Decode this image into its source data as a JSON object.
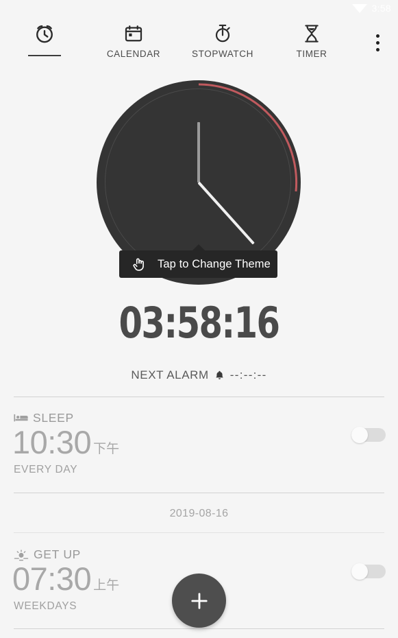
{
  "status_bar": {
    "wifi_icon": "wifi-icon",
    "time": "3:58"
  },
  "tabs": [
    {
      "icon": "alarm-clock-icon",
      "label": "",
      "selected": true
    },
    {
      "icon": "calendar-icon",
      "label": "CALENDAR",
      "selected": false
    },
    {
      "icon": "stopwatch-icon",
      "label": "STOPWATCH",
      "selected": false
    },
    {
      "icon": "hourglass-timer-icon",
      "label": "TIMER",
      "selected": false
    }
  ],
  "overflow_menu": {
    "icon": "more-vertical-icon"
  },
  "clock": {
    "face_color": "#343434",
    "arc_color": "#c05a5e",
    "hour_hand_color": "#9b9b9b",
    "minute_hand_color": "#f0f0f0",
    "seconds_progress_deg": 96
  },
  "tooltip": {
    "icon": "tap-hand-icon",
    "text": "Tap to Change Theme"
  },
  "digital_clock": {
    "time": "03:58:16"
  },
  "next_alarm": {
    "label": "NEXT ALARM",
    "icon": "bell-icon",
    "time": "--:--:--"
  },
  "alarms": [
    {
      "icon": "bed-icon",
      "name": "SLEEP",
      "time": "10:30",
      "ampm": "下午",
      "repeat": "EVERY DAY",
      "enabled": false
    },
    {
      "icon": "sunrise-icon",
      "name": "GET UP",
      "time": "07:30",
      "ampm": "上午",
      "repeat": "WEEKDAYS",
      "enabled": false
    }
  ],
  "date_divider": {
    "date": "2019-08-16"
  },
  "fab": {
    "icon": "plus-icon",
    "label": "Add alarm"
  },
  "colors": {
    "background": "#f5f5f5",
    "accent_red": "#c05a5e",
    "dark": "#343434"
  }
}
